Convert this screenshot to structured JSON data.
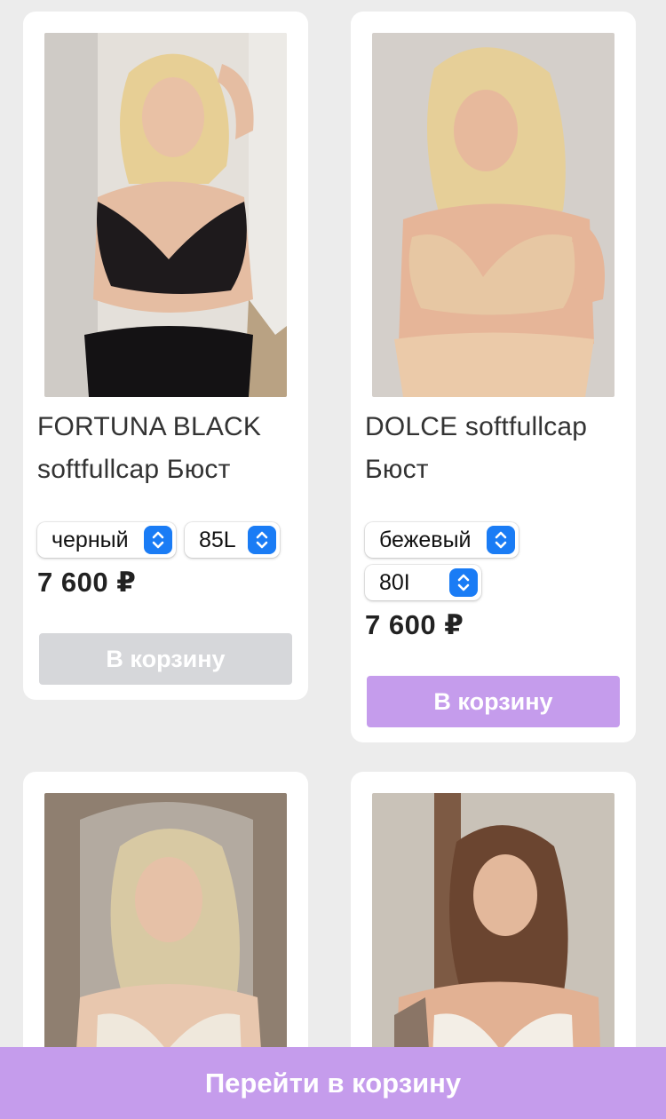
{
  "colors": {
    "accent": "#c59cec",
    "disabled": "#d6d7da",
    "stepper": "#1a7cf5",
    "page_bg": "#ececec"
  },
  "products": [
    {
      "title_line1": "FORTUNA BLACK",
      "title_line2": "softfullcap Бюст",
      "color_option": "черный",
      "size_option": "85L",
      "price": "7 600 ₽",
      "cart_label": "В корзину",
      "cart_enabled": false
    },
    {
      "title_line1": "DOLCE softfullcap",
      "title_line2": "Бюст",
      "color_option": "бежевый",
      "size_option": "80I",
      "price": "7 600 ₽",
      "cart_label": "В корзину",
      "cart_enabled": true
    }
  ],
  "bottom_bar": {
    "label": "Перейти в корзину"
  }
}
